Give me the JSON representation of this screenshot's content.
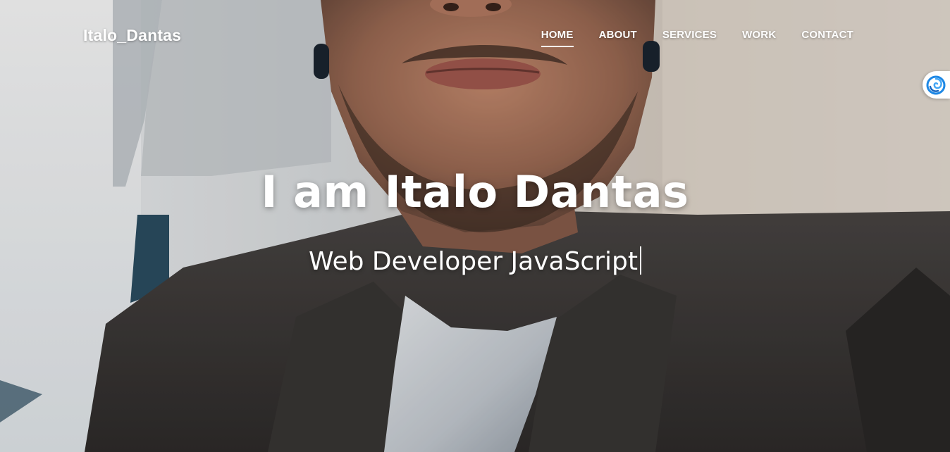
{
  "header": {
    "brand": "Italo_Dantas",
    "nav": [
      {
        "label": "HOME",
        "active": true
      },
      {
        "label": "ABOUT",
        "active": false
      },
      {
        "label": "SERVICES",
        "active": false
      },
      {
        "label": "WORK",
        "active": false
      },
      {
        "label": "CONTACT",
        "active": false
      }
    ]
  },
  "hero": {
    "headline": "I am Italo Dantas",
    "subline": "Web Developer JavaScript"
  },
  "extension": {
    "icon": "swirl-logo-icon"
  },
  "colors": {
    "text": "#ffffff",
    "suit": "#3b3836",
    "wall": "#e9e2d8",
    "skin": "#b07a60",
    "extension_accent": "#1e88e5"
  }
}
